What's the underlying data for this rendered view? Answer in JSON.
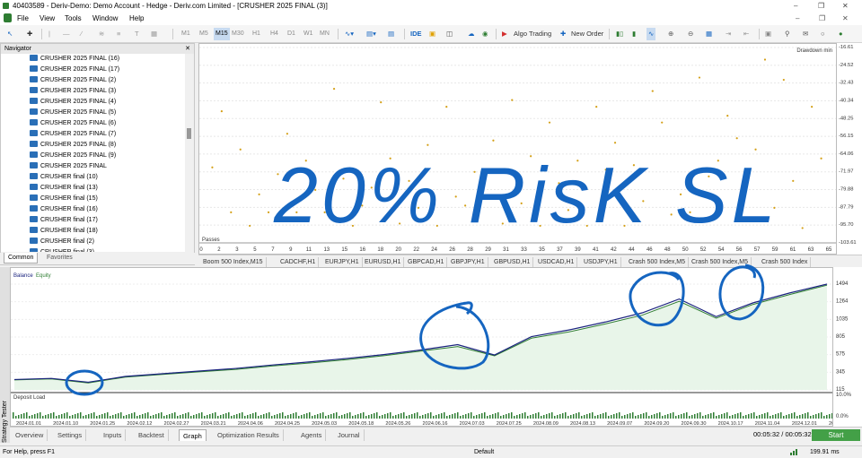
{
  "window": {
    "title": "40403589 - Deriv-Demo: Demo Account - Hedge - Deriv.com Limited - [CRUSHER 2025 FINAL (3)]"
  },
  "menu": [
    "File",
    "View",
    "Tools",
    "Window",
    "Help"
  ],
  "toolbar": {
    "timeframes": [
      "M1",
      "M5",
      "M15",
      "M30",
      "H1",
      "H4",
      "D1",
      "W1",
      "MN"
    ],
    "ide": "IDE",
    "algo_trading": "Algo Trading",
    "new_order": "New Order"
  },
  "navigator": {
    "title": "Navigator",
    "items": [
      "CRUSHER 2025 FINAL (16)",
      "CRUSHER 2025 FINAL (17)",
      "CRUSHER 2025 FINAL (2)",
      "CRUSHER 2025 FINAL (3)",
      "CRUSHER 2025 FINAL (4)",
      "CRUSHER 2025 FINAL (5)",
      "CRUSHER 2025 FINAL (6)",
      "CRUSHER 2025 FINAL (7)",
      "CRUSHER 2025 FINAL (8)",
      "CRUSHER 2025 FINAL (9)",
      "CRUSHER 2025 FINAL",
      "CRUSHER final (10)",
      "CRUSHER final (13)",
      "CRUSHER final (15)",
      "CRUSHER final (16)",
      "CRUSHER final (17)",
      "CRUSHER final (18)",
      "CRUSHER final (2)",
      "CRUSHER final (3)"
    ],
    "tabs": [
      "Common",
      "Favorites"
    ]
  },
  "chart_data": [
    {
      "type": "scatter",
      "title": "Drawdown min",
      "xlabel": "Passes",
      "xticks": [
        "0",
        "2",
        "3",
        "5",
        "7",
        "9",
        "11",
        "13",
        "15",
        "16",
        "18",
        "20",
        "22",
        "24",
        "26",
        "28",
        "29",
        "31",
        "33",
        "35",
        "37",
        "39",
        "41",
        "42",
        "44",
        "46",
        "48",
        "50",
        "52",
        "54",
        "56",
        "57",
        "59",
        "61",
        "63",
        "65"
      ],
      "yticks": [
        "-16.61",
        "-24.52",
        "-32.43",
        "-40.34",
        "-48.25",
        "-56.15",
        "-64.06",
        "-71.97",
        "-79.88",
        "-87.79",
        "-95.70",
        "-103.61"
      ],
      "ylim": [
        -103.61,
        -16.61
      ],
      "color": "#d4a017",
      "series": [
        {
          "values": [
            [
              1,
              -70
            ],
            [
              2,
              -45
            ],
            [
              3,
              -90
            ],
            [
              4,
              -62
            ],
            [
              5,
              -96
            ],
            [
              6,
              -82
            ],
            [
              7,
              -90
            ],
            [
              8,
              -73
            ],
            [
              9,
              -55
            ],
            [
              10,
              -90
            ],
            [
              11,
              -67
            ],
            [
              12,
              -80
            ],
            [
              13,
              -90
            ],
            [
              14,
              -35
            ],
            [
              15,
              -75
            ],
            [
              16,
              -96
            ],
            [
              17,
              -87
            ],
            [
              18,
              -79
            ],
            [
              19,
              -41
            ],
            [
              20,
              -66
            ],
            [
              21,
              -95
            ],
            [
              22,
              -76
            ],
            [
              23,
              -88
            ],
            [
              24,
              -60
            ],
            [
              25,
              -96
            ],
            [
              26,
              -43
            ],
            [
              27,
              -83
            ],
            [
              28,
              -87
            ],
            [
              29,
              -72
            ],
            [
              30,
              -76
            ],
            [
              31,
              -58
            ],
            [
              32,
              -95
            ],
            [
              33,
              -40
            ],
            [
              34,
              -86
            ],
            [
              35,
              -65
            ],
            [
              36,
              -96
            ],
            [
              37,
              -50
            ],
            [
              38,
              -77
            ],
            [
              39,
              -89
            ],
            [
              40,
              -67
            ],
            [
              41,
              -96
            ],
            [
              42,
              -43
            ],
            [
              43,
              -71
            ],
            [
              44,
              -59
            ],
            [
              45,
              -96
            ],
            [
              46,
              -69
            ],
            [
              47,
              -85
            ],
            [
              48,
              -36
            ],
            [
              49,
              -50
            ],
            [
              50,
              -91
            ],
            [
              51,
              -82
            ],
            [
              52,
              -90
            ],
            [
              53,
              -30
            ],
            [
              54,
              -74
            ],
            [
              55,
              -67
            ],
            [
              56,
              -47
            ],
            [
              57,
              -57
            ],
            [
              58,
              -80
            ],
            [
              59,
              -62
            ],
            [
              60,
              -22
            ],
            [
              61,
              -88
            ],
            [
              62,
              -31
            ],
            [
              63,
              -76
            ],
            [
              64,
              -97
            ],
            [
              65,
              -43
            ],
            [
              66,
              -66
            ]
          ]
        }
      ]
    },
    {
      "type": "area",
      "legend": [
        "Balance",
        "Equity"
      ],
      "x": [
        "2024.01.01",
        "2024.01.10",
        "2024.01.25",
        "2024.02.12",
        "2024.02.27",
        "2024.03.21",
        "2024.04.06",
        "2024.04.25",
        "2024.05.03",
        "2024.05.18",
        "2024.05.26",
        "2024.06.16",
        "2024.07.03",
        "2024.07.25",
        "2024.08.09",
        "2024.08.13",
        "2024.09.07",
        "2024.09.20",
        "2024.09.30",
        "2024.10.17",
        "2024.11.04",
        "2024.12.01",
        "2024.12.20"
      ],
      "yticks": [
        "1494",
        "1264",
        "1035",
        "805",
        "575",
        "345",
        "115"
      ],
      "ylim": [
        115,
        1494
      ],
      "series": [
        {
          "name": "Balance",
          "color": "#1a237e",
          "values": [
            250,
            265,
            215,
            290,
            325,
            360,
            395,
            440,
            480,
            525,
            575,
            635,
            705,
            570,
            810,
            895,
            1000,
            1120,
            1300,
            1070,
            1250,
            1380,
            1494
          ]
        },
        {
          "name": "Equity",
          "color": "#2e7d32",
          "values": [
            245,
            258,
            205,
            282,
            316,
            350,
            382,
            428,
            465,
            510,
            560,
            620,
            680,
            560,
            790,
            870,
            975,
            1090,
            1270,
            1050,
            1230,
            1360,
            1480
          ]
        }
      ],
      "deposit_load": {
        "label": "Deposit Load",
        "yticks": [
          "10.0%",
          "0.0%"
        ]
      }
    }
  ],
  "symbol_tabs": [
    "Boom 500 Index,M15",
    "CADCHF,H1",
    "EURJPY,H1",
    "EURUSD,H1",
    "GBPCAD,H1",
    "GBPJPY,H1",
    "GBPUSD,H1",
    "USDCAD,H1",
    "USDJPY,H1",
    "Crash 500 Index,M5",
    "Crash 500 Index,M5",
    "Crash 500 Index"
  ],
  "bottom_tabs": [
    "Overview",
    "Settings",
    "Inputs",
    "Backtest",
    "Graph",
    "Optimization Results",
    "Agents",
    "Journal"
  ],
  "active_tab": "Graph",
  "strategy_tester_label": "Strategy Tester",
  "timer": "00:05:32 / 00:05:32",
  "start_label": "Start",
  "status": {
    "help": "For Help, press F1",
    "profile": "Default",
    "ping": "199.91 ms"
  },
  "annotation": {
    "text": "20% RisK SL",
    "color": "#1565c0"
  }
}
